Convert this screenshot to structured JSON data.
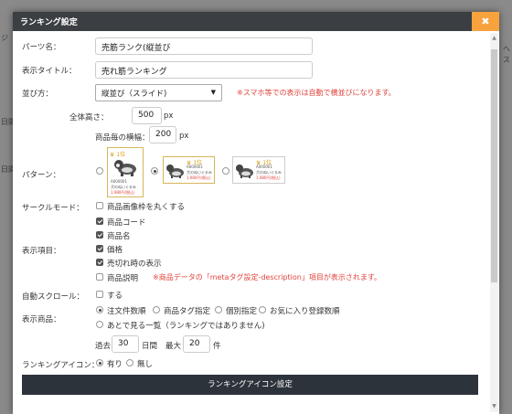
{
  "background": {
    "fragments": [
      "ジ",
      "日間",
      "日間",
      "へ",
      "ス"
    ]
  },
  "dialog": {
    "title": "ランキング設定",
    "close": "✖"
  },
  "fields": {
    "parts_name": {
      "label": "パーツ名：",
      "value": "売筋ランク(縦並び"
    },
    "display_title": {
      "label": "表示タイトル：",
      "value": "売れ筋ランキング"
    },
    "arrangement": {
      "label": "並び方：",
      "value": "縦並び（スライド)",
      "note": "※スマホ等での表示は自動で横並びになります。"
    },
    "total_height": {
      "label": "全体高さ：",
      "value": "500",
      "unit": "px"
    },
    "item_width": {
      "label": "商品毎の横幅：",
      "value": "200",
      "unit": "px"
    },
    "pattern": {
      "label": "パターン：",
      "selected": 1
    },
    "circle_mode": {
      "label": "サークルモード：",
      "option": "商品画像枠を丸くする",
      "checked": false
    },
    "display_items": {
      "label": "表示項目：",
      "options": [
        {
          "label": "商品コード",
          "checked": true
        },
        {
          "label": "商品名",
          "checked": true
        },
        {
          "label": "価格",
          "checked": true
        },
        {
          "label": "売切れ時の表示",
          "checked": true
        },
        {
          "label": "商品説明",
          "checked": false
        }
      ],
      "note": "※商品データの「metaタグ設定-description」項目が表示されます。"
    },
    "auto_scroll": {
      "label": "自動スクロール：",
      "option": "する",
      "checked": false
    },
    "display_products": {
      "label": "表示商品：",
      "options": [
        "注文件数順",
        "商品タグ指定",
        "個別指定",
        "お気に入り登録数順",
        "あとで見る一覧（ランキングではありません)"
      ],
      "selected": 0
    },
    "period": {
      "prefix": "過去",
      "days": "30",
      "days_unit": "日間",
      "max_label": "最大",
      "max": "20",
      "max_unit": "件"
    },
    "ranking_icon": {
      "label": "ランキングアイコン：",
      "options": [
        "有り",
        "無し"
      ],
      "selected": 0
    }
  },
  "pattern_card": {
    "code": "A000001",
    "name": "犬のぬいぐるみ",
    "price": "1,980円(税込)",
    "crown": "♛ 1位"
  },
  "button": {
    "label": "ランキングアイコン設定"
  },
  "colors": {
    "accent": "#f7a23d",
    "titlebar": "#3b3f44",
    "note": "#e0443e",
    "button": "#2d333b"
  }
}
